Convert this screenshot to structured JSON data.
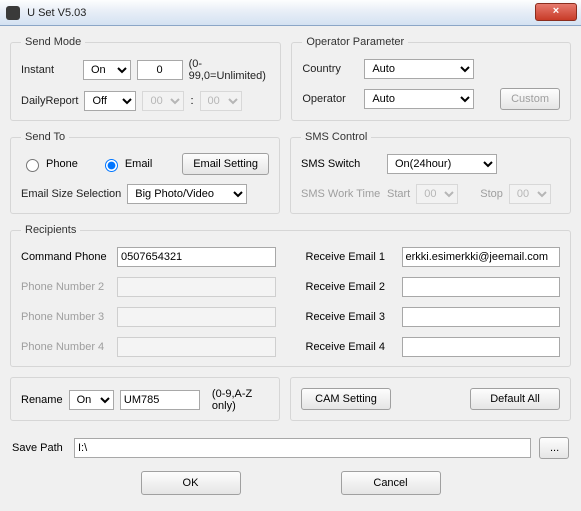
{
  "window": {
    "title": "U Set V5.03",
    "close": "×"
  },
  "sendMode": {
    "legend": "Send Mode",
    "instantLabel": "Instant",
    "instantValue": "On",
    "instantCount": "0",
    "instantHint": "(0-99,0=Unlimited)",
    "dailyLabel": "DailyReport",
    "dailyValue": "Off",
    "dailyHour": "00",
    "dailyMin": "00",
    "timeSep": ":"
  },
  "opParam": {
    "legend": "Operator Parameter",
    "countryLabel": "Country",
    "countryValue": "Auto",
    "operatorLabel": "Operator",
    "operatorValue": "Auto",
    "customBtn": "Custom"
  },
  "sendTo": {
    "legend": "Send To",
    "phoneLabel": "Phone",
    "emailLabel": "Email",
    "emailSettingBtn": "Email Setting",
    "sizeLabel": "Email Size Selection",
    "sizeValue": "Big Photo/Video"
  },
  "smsCtrl": {
    "legend": "SMS Control",
    "switchLabel": "SMS Switch",
    "switchValue": "On(24hour)",
    "workTimeLabel": "SMS Work Time",
    "startLabel": "Start",
    "startValue": "00",
    "stopLabel": "Stop",
    "stopValue": "00"
  },
  "recipients": {
    "legend": "Recipients",
    "cmdPhoneLabel": "Command Phone",
    "cmdPhoneValue": "0507654321",
    "phone2Label": "Phone Number 2",
    "phone3Label": "Phone Number 3",
    "phone4Label": "Phone Number 4",
    "email1Label": "Receive Email 1",
    "email1Value": "erkki.esimerkki@jeemail.com",
    "email2Label": "Receive Email 2",
    "email3Label": "Receive Email 3",
    "email4Label": "Receive Email 4"
  },
  "rename": {
    "label": "Rename",
    "mode": "On",
    "value": "UM785",
    "hint": "(0-9,A-Z only)"
  },
  "sideBtns": {
    "camSetting": "CAM Setting",
    "defaultAll": "Default All"
  },
  "savePath": {
    "label": "Save Path",
    "value": "I:\\",
    "browse": "..."
  },
  "footer": {
    "ok": "OK",
    "cancel": "Cancel"
  }
}
